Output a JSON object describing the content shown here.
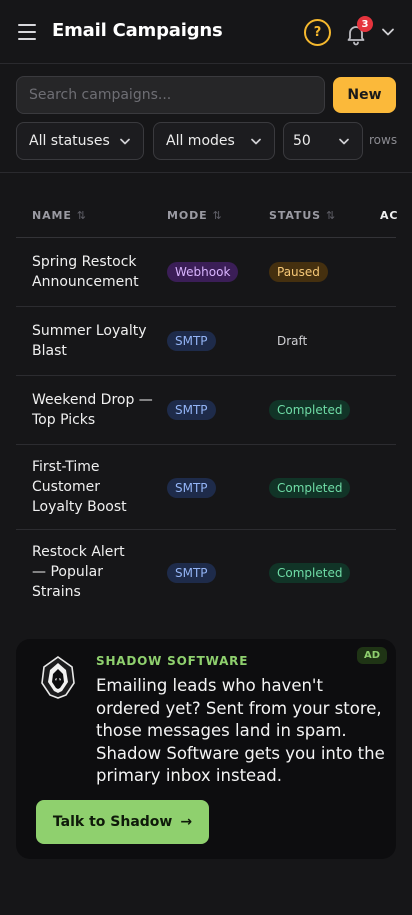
{
  "header": {
    "title": "Email Campaigns",
    "help_glyph": "?",
    "notification_count": "3",
    "icons": [
      "menu-icon",
      "help-icon",
      "bell-icon",
      "chevron-down-icon"
    ]
  },
  "toolbar": {
    "search_placeholder": "Search campaigns...",
    "search_value": "",
    "new_label": "New",
    "status_filter": "All statuses",
    "mode_filter": "All modes",
    "page_size": "50",
    "rows_label": "rows"
  },
  "table": {
    "columns": [
      {
        "label": "NAME",
        "sort": "⇅"
      },
      {
        "label": "MODE",
        "sort": "⇅"
      },
      {
        "label": "STATUS",
        "sort": "⇅"
      },
      {
        "label": "AC",
        "sort": ""
      }
    ],
    "rows": [
      {
        "name": "Spring Restock Announcement",
        "mode": "Webhook",
        "status": "Paused"
      },
      {
        "name": "Summer Loyalty Blast",
        "mode": "SMTP",
        "status": "Draft"
      },
      {
        "name": "Weekend Drop — Top Picks",
        "mode": "SMTP",
        "status": "Completed"
      },
      {
        "name": "First-Time Customer Loyalty Boost",
        "mode": "SMTP",
        "status": "Completed"
      },
      {
        "name": "Restock Alert — Popular Strains",
        "mode": "SMTP",
        "status": "Completed"
      }
    ]
  },
  "ad": {
    "brand": "SHADOW SOFTWARE",
    "tag": "AD",
    "text": "Emailing leads who haven't ordered yet? Sent from your store, those messages land in spam. Shadow Software gets you into the primary inbox instead.",
    "cta_label": "Talk to Shadow",
    "cta_arrow": "→"
  },
  "colors": {
    "background": "#161618",
    "accent": "#fbb93a",
    "ad_accent": "#8fd06e",
    "badge": "#e5343d"
  }
}
